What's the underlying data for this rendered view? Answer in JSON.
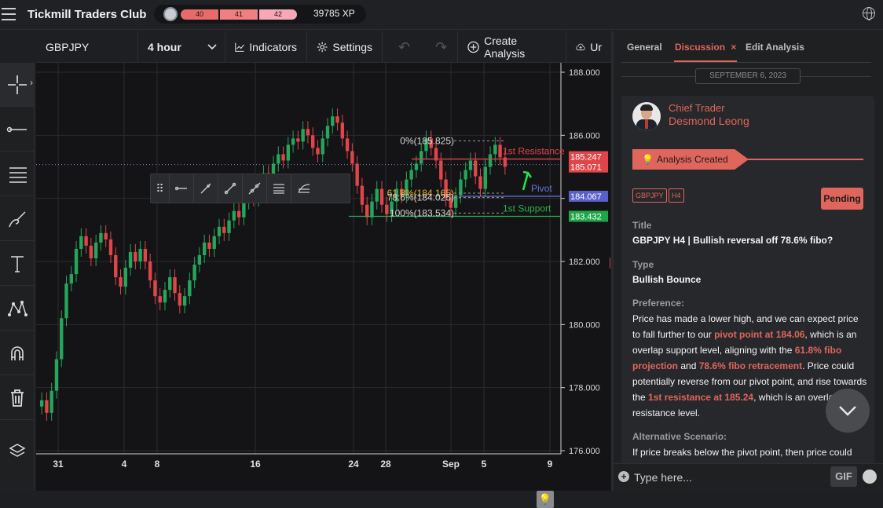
{
  "app": {
    "title": "Tickmill Traders Club",
    "xp": "39785 XP",
    "levels": [
      "40",
      "41",
      "42"
    ]
  },
  "toolbar": {
    "symbol": "GBPJPY",
    "timeframe": "4 hour",
    "indicators": "Indicators",
    "settings": "Settings",
    "create_analysis": "Create Analysis",
    "upload": "Ur"
  },
  "left_tools": [
    "crosshair-icon",
    "line-tool-icon",
    "fib-tool-icon",
    "brush-icon",
    "text-tool-icon",
    "pattern-icon",
    "magnet-icon",
    "trash-icon",
    "layers-icon"
  ],
  "chart_data": {
    "type": "candlestick",
    "symbol": "GBPJPY",
    "timeframe": "4 hour",
    "x_ticks": [
      "31",
      "4",
      "8",
      "16",
      "24",
      "28",
      "Sep",
      "5",
      "9"
    ],
    "y_ticks": [
      "188.000",
      "186.000",
      "184.000",
      "182.000",
      "180.000",
      "178.000",
      "176.000"
    ],
    "ylim": [
      176.0,
      188.0
    ],
    "price_labels": [
      {
        "text": "185.247",
        "color": "#e0454a"
      },
      {
        "text": "185.071",
        "color": "#e0454a"
      },
      {
        "text": "184.067",
        "color": "#5960c8"
      },
      {
        "text": "183.432",
        "color": "#1fa64a"
      }
    ],
    "levels": [
      {
        "name": "1st Resistance",
        "value": 185.247,
        "color": "#e0454a"
      },
      {
        "name": "Pivot",
        "value": 184.067,
        "color": "#6b72e0"
      },
      {
        "name": "1st Support",
        "value": 183.432,
        "color": "#26b24f"
      }
    ],
    "fib_labels": [
      "0%(185.825)",
      "61.8%(184.165)",
      "78.6%(184.025)",
      "100%(183.534)"
    ],
    "candles_close": [
      177.6,
      177.2,
      177.9,
      178.9,
      180.2,
      181.3,
      181.6,
      182.4,
      182.8,
      182.5,
      182.1,
      182.6,
      182.9,
      182.7,
      182.2,
      181.5,
      181.2,
      181.8,
      182.3,
      182.0,
      182.4,
      182.0,
      181.4,
      180.9,
      180.7,
      181.1,
      181.5,
      181.0,
      180.6,
      180.9,
      181.4,
      181.9,
      182.2,
      182.6,
      182.4,
      182.8,
      183.1,
      182.9,
      183.3,
      183.6,
      183.4,
      183.9,
      184.2,
      184.0,
      184.4,
      184.8,
      184.6,
      185.1,
      185.4,
      185.2,
      185.7,
      185.9,
      185.8,
      186.2,
      186.0,
      185.6,
      185.4,
      185.9,
      186.3,
      186.6,
      186.4,
      185.9,
      185.5,
      185.1,
      184.4,
      183.8,
      183.4,
      183.9,
      184.3,
      183.8,
      183.5,
      183.9,
      184.3,
      184.1,
      184.6,
      184.9,
      185.1,
      185.5,
      185.9,
      185.6,
      185.2,
      184.6,
      184.0,
      183.7,
      184.1,
      184.6,
      184.9,
      185.2,
      184.7,
      184.3,
      185.0,
      185.4,
      185.7,
      185.3,
      185.0
    ]
  },
  "chart_misc": {
    "drawing_tools": [
      "grip-icon",
      "ray-icon",
      "segment-icon",
      "trend-line-icon",
      "extended-line-icon",
      "parallel-channel-icon",
      "fib-channel-icon"
    ]
  },
  "panel": {
    "tabs": [
      "General",
      "Discussion",
      "Edit Analysis"
    ],
    "tab_close": "×",
    "date": "SEPTEMBER 6, 2023",
    "role": "Chief Trader",
    "author": "Desmond Leong",
    "status_ribbon": "Analysis Created",
    "tags": [
      "GBPJPY",
      "H4"
    ],
    "status": "Pending",
    "title_label": "Title",
    "title": "GBPJPY H4 | Bullish reversal off 78.6% fibo?",
    "type_label": "Type",
    "type": "Bullish Bounce",
    "preference_label": "Preference:",
    "preference": [
      {
        "t": "Price has made a lower high, and we can expect price to fall further to our ",
        "h": false
      },
      {
        "t": "pivot point at 184.06",
        "h": true
      },
      {
        "t": ", which is an overlap support level, aligning with the ",
        "h": false
      },
      {
        "t": "61.8% fibo projection",
        "h": true
      },
      {
        "t": " and ",
        "h": false
      },
      {
        "t": "78.6% fibo retracement",
        "h": true
      },
      {
        "t": ". Price could potentially reverse from our pivot point, and rise towards the ",
        "h": false
      },
      {
        "t": "1st resistance at 185.24",
        "h": true
      },
      {
        "t": ", which is an overlap resistance level.",
        "h": false
      }
    ],
    "alt_label": "Alternative Scenario:",
    "alt_text": "If price breaks below the pivot point, then price could",
    "input_placeholder": "Type here...",
    "gif": "GIF"
  },
  "colors": {
    "accent": "#e0655c",
    "up": "#26a65b",
    "down": "#e0454a",
    "bg": "#141416"
  }
}
